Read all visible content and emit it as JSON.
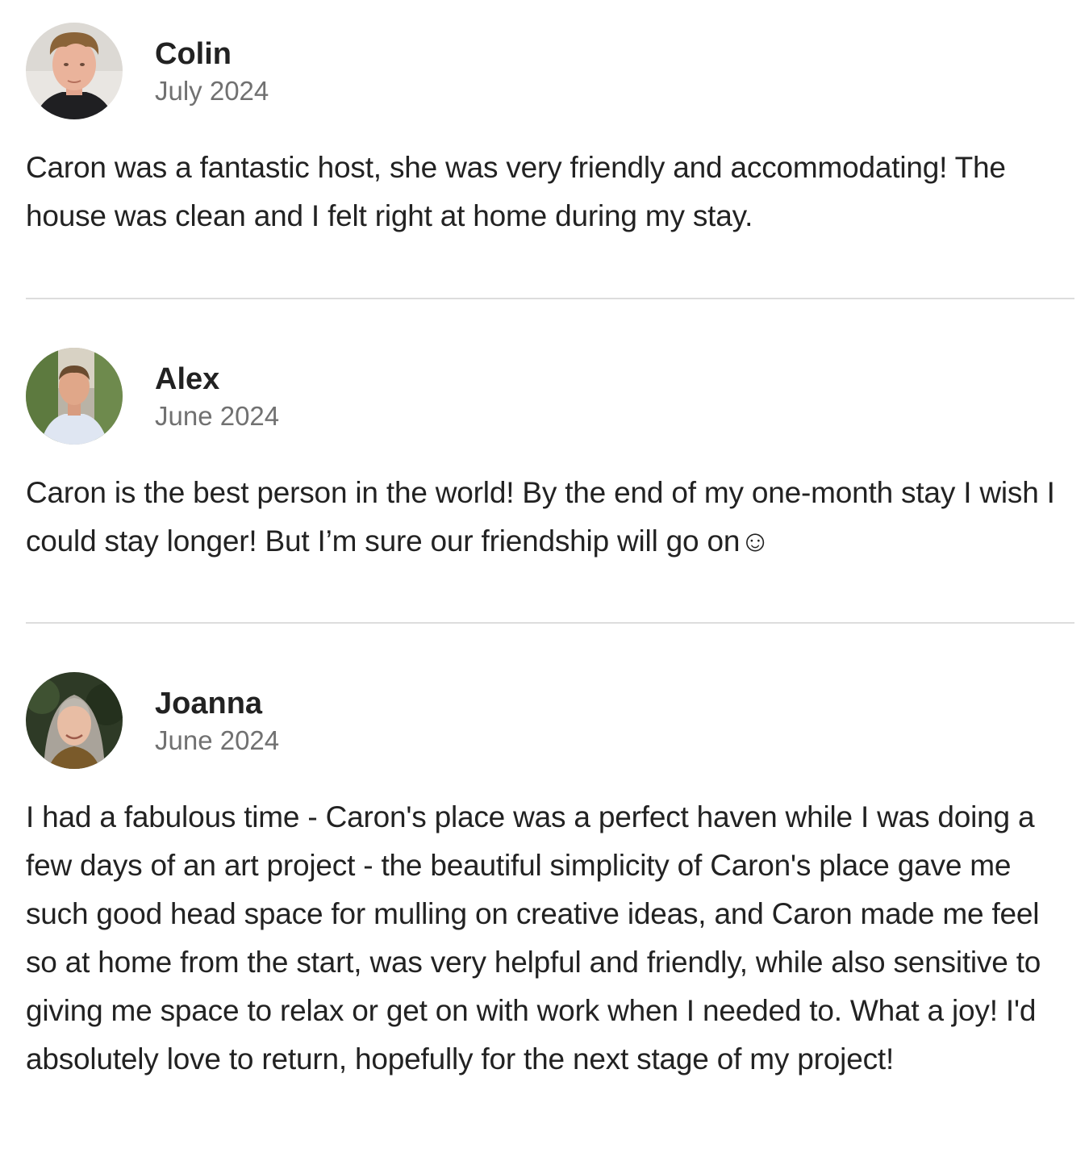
{
  "reviews": [
    {
      "name": "Colin",
      "date": "July 2024",
      "text": "Caron was a fantastic host, she was very friendly and accommodating! The house was clean and I felt right at home during my stay."
    },
    {
      "name": "Alex",
      "date": "June 2024",
      "text": "Caron is the best person in the world! By the end of my one-month stay I wish I could stay longer! But I’m sure our friendship will go on☺"
    },
    {
      "name": "Joanna",
      "date": "June 2024",
      "text": "I had a fabulous time - Caron's place was a perfect haven while I was doing a few days of an art project - the beautiful simplicity of Caron's place gave me such good head space for mulling on creative ideas, and Caron made me feel so at home from the start, was very helpful and friendly, while also sensitive to giving me space to relax or get on with work when I needed to. What a joy! I'd absolutely love to return, hopefully for the next stage of my project!"
    }
  ]
}
